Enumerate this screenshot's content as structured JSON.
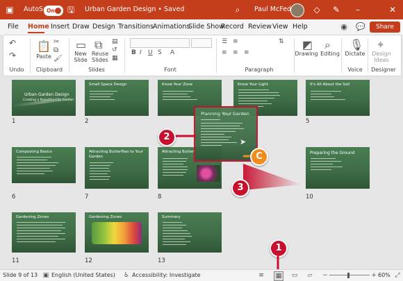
{
  "titlebar": {
    "autosave": "AutoSave",
    "toggle": "On",
    "doc_title": "Urban Garden Design • Saved",
    "user": "Paul McFedries"
  },
  "menu": [
    "File",
    "Home",
    "Insert",
    "Draw",
    "Design",
    "Transitions",
    "Animations",
    "Slide Show",
    "Record",
    "Review",
    "View",
    "Help"
  ],
  "share": "Share",
  "ribbon": {
    "undo_group": "Undo",
    "paste": "Paste",
    "clipboard_group": "Clipboard",
    "new_slide": "New Slide",
    "reuse_slides": "Reuse Slides",
    "slides_group": "Slides",
    "font_group": "Font",
    "paragraph_group": "Paragraph",
    "drawing": "Drawing",
    "editing": "Editing",
    "dictate": "Dictate",
    "voice_group": "Voice",
    "design_ideas": "Design Ideas",
    "designer_group": "Designer"
  },
  "slides": [
    {
      "num": "1",
      "title": "Urban Garden Design",
      "sub": "Creating a Beautiful City Garden"
    },
    {
      "num": "2",
      "title": "Small Space Design"
    },
    {
      "num": "",
      "title": "Know Your Zone"
    },
    {
      "num": "",
      "title": "Know Your Light"
    },
    {
      "num": "5",
      "title": "It's All About the Soil"
    },
    {
      "num": "6",
      "title": "Composting Basics"
    },
    {
      "num": "7",
      "title": "Attracting Butterflies to Your Garden"
    },
    {
      "num": "8",
      "title": "Attracting Butterf"
    },
    {
      "num": "10",
      "title": "Preparing the Ground"
    },
    {
      "num": "11",
      "title": "Gardening Zones"
    },
    {
      "num": "12",
      "title": "Gardening Zones"
    },
    {
      "num": "13",
      "title": "Summary"
    }
  ],
  "dragged_slide": {
    "title": "Planning Your Garden"
  },
  "callouts": {
    "c1": "1",
    "c2": "2",
    "c3": "3",
    "cc": "C"
  },
  "status": {
    "slide": "Slide 9 of 13",
    "language": "English (United States)",
    "accessibility": "Accessibility: Investigate",
    "zoom": "60%"
  },
  "colors": {
    "accent": "#c43e1c",
    "slide_bg": "#3f7048",
    "callout_red": "#c8102e",
    "callout_orange": "#f28c1e"
  },
  "icons": [
    "search-icon",
    "diamond-icon",
    "pen-icon",
    "minimize-icon",
    "close-icon",
    "comment-icon",
    "undo-icon",
    "paste-icon",
    "new-slide-icon",
    "reuse-slides-icon",
    "drawing-icon",
    "editing-icon",
    "mic-icon",
    "design-ideas-icon",
    "slide-sorter-icon",
    "normal-view-icon",
    "reading-view-icon",
    "slideshow-icon",
    "fit-icon",
    "accessibility-icon"
  ]
}
